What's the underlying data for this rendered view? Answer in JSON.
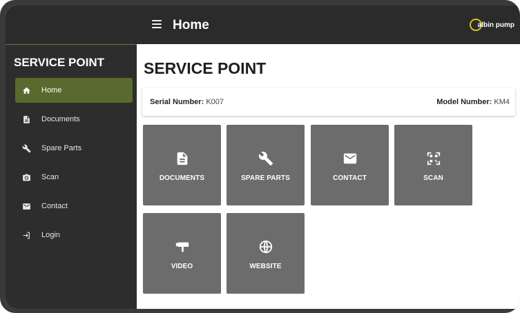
{
  "appbar": {
    "title": "Home",
    "brand": "albin pump"
  },
  "sidebar": {
    "title": "SERVICE POINT",
    "items": [
      {
        "label": "Home",
        "icon": "home-icon"
      },
      {
        "label": "Documents",
        "icon": "document-icon"
      },
      {
        "label": "Spare Parts",
        "icon": "wrench-icon"
      },
      {
        "label": "Scan",
        "icon": "camera-icon"
      },
      {
        "label": "Contact",
        "icon": "envelope-icon"
      },
      {
        "label": "Login",
        "icon": "login-icon"
      }
    ]
  },
  "main": {
    "title": "SERVICE POINT",
    "serial_label": "Serial Number:",
    "serial_value": "K007",
    "model_label": "Model Number:",
    "model_value": "KM4",
    "tiles": [
      {
        "label": "DOCUMENTS",
        "icon": "document-icon"
      },
      {
        "label": "SPARE PARTS",
        "icon": "wrench-icon"
      },
      {
        "label": "CONTACT",
        "icon": "envelope-icon"
      },
      {
        "label": "SCAN",
        "icon": "qr-scan-icon"
      },
      {
        "label": "VIDEO",
        "icon": "video-camera-icon"
      },
      {
        "label": "WEBSITE",
        "icon": "globe-icon"
      }
    ]
  },
  "colors": {
    "appbar": "#2b2b2b",
    "sidebar": "#2d2d2d",
    "active_item": "#5a6a2e",
    "tile": "#6c6c6c",
    "brand_accent": "#d8c21f"
  }
}
